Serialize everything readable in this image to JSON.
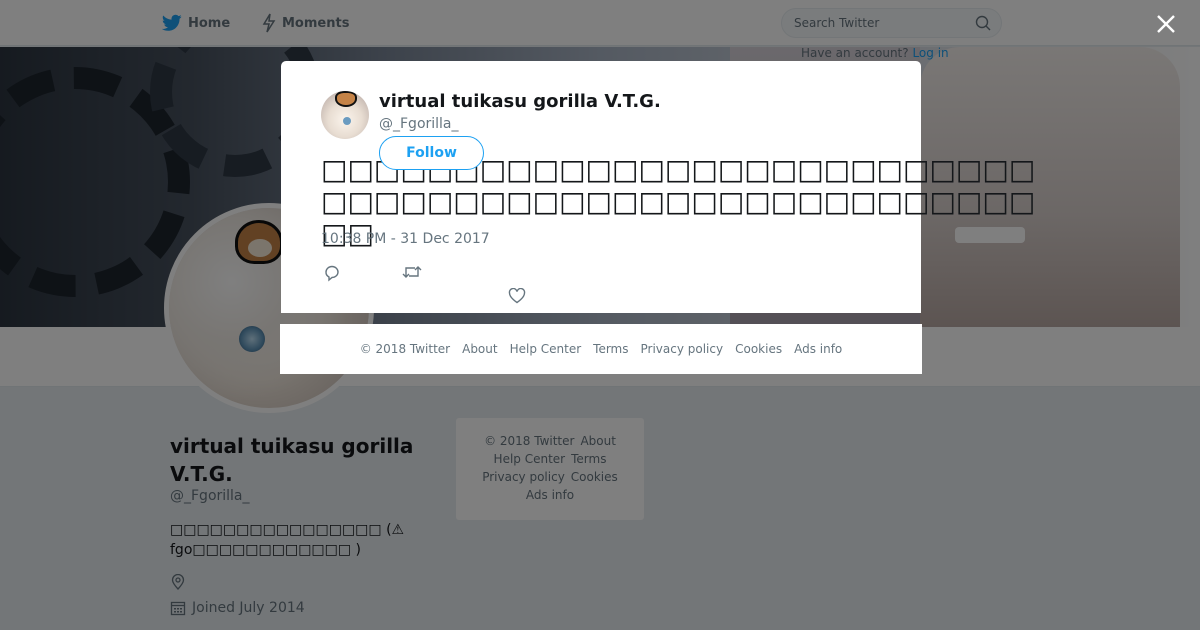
{
  "nav": {
    "home_label": "Home",
    "moments_label": "Moments",
    "search_placeholder": "Search Twitter",
    "login_hint": "Have an account?",
    "login_link": "Log in"
  },
  "profile": {
    "name": "virtual tuikasu gorilla V.T.G.",
    "handle": "@_Fgorilla_",
    "bio": "□□□□□□□□□□□□□□□□ (⚠ fgo□□□□□□□□□□□□ )",
    "joined": "Joined July 2014"
  },
  "sidebar_footer": {
    "copyright": "© 2018 Twitter",
    "about": "About",
    "help": "Help Center",
    "terms": "Terms",
    "privacy": "Privacy policy",
    "cookies": "Cookies",
    "ads": "Ads info"
  },
  "tweet": {
    "author_name": "virtual tuikasu gorilla V.T.G.",
    "author_handle": "@_Fgorilla_",
    "follow_label": "Follow",
    "text": "□□□□□□□□□□□□□□□□□□□□□□□□□□□□□□□□□□□□□□□□□□□□□□□□□□□□□□□□",
    "timestamp": "10:38 PM - 31 Dec 2017"
  },
  "modal_footer": {
    "copyright": "© 2018 Twitter",
    "about": "About",
    "help": "Help Center",
    "terms": "Terms",
    "privacy": "Privacy policy",
    "cookies": "Cookies",
    "ads": "Ads info"
  },
  "icons": {
    "twitter_bird": "twitter-bird-icon",
    "moments": "lightning-icon",
    "search": "search-icon",
    "close": "close-icon",
    "reply": "reply-icon",
    "retweet": "retweet-icon",
    "like": "heart-icon",
    "location": "location-icon",
    "calendar": "calendar-icon"
  },
  "colors": {
    "brand": "#1da1f2",
    "text_secondary": "#66757f",
    "background": "#e6ecf0"
  }
}
